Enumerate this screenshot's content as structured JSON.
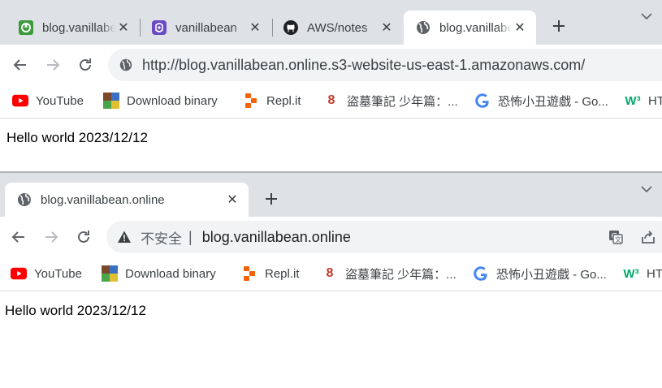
{
  "top_window": {
    "tabs": [
      {
        "title": "blog.vanillabean.online",
        "icon": "vanillabean-green-icon",
        "active": false
      },
      {
        "title": "vanillabean",
        "icon": "vanillabean-purple-icon",
        "active": false
      },
      {
        "title": "AWS/notes",
        "icon": "github-icon",
        "active": false
      },
      {
        "title": "blog.vanillabean.online",
        "icon": "globe-icon",
        "active": true
      }
    ],
    "address": "http://blog.vanillabean.online.s3-website-us-east-1.amazonaws.com/",
    "page_text": "Hello world 2023/12/12"
  },
  "bottom_window": {
    "tabs": [
      {
        "title": "blog.vanillabean.online",
        "icon": "globe-icon",
        "active": true
      }
    ],
    "security_label": "不安全",
    "address": "blog.vanillabean.online",
    "page_text": "Hello world 2023/12/12"
  },
  "bookmarks": [
    {
      "label": "YouTube",
      "icon": "youtube-icon"
    },
    {
      "label": "Download binary",
      "icon": "download-binary-icon"
    },
    {
      "label": "Repl.it",
      "icon": "replit-icon"
    },
    {
      "label": "盜墓筆記 少年篇：...",
      "icon": "number-8-icon"
    },
    {
      "label": "恐怖小丑遊戲 - Go...",
      "icon": "google-icon"
    },
    {
      "label": "HT",
      "icon": "w3-icon"
    }
  ],
  "colors": {
    "tabstrip": "#dee1e6",
    "omnibox": "#f1f3f4",
    "youtube_red": "#ff0000",
    "replit_orange": "#f26207"
  }
}
